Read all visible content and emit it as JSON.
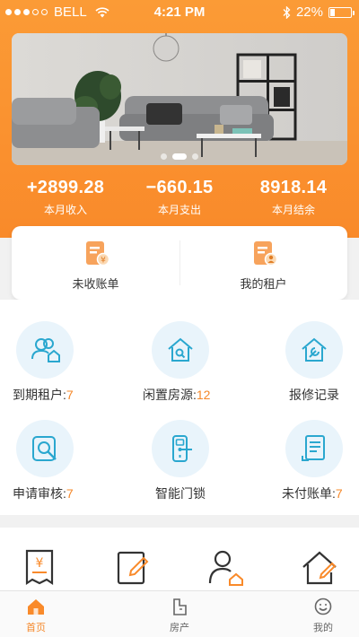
{
  "status_bar": {
    "carrier": "BELL",
    "time": "4:21 PM",
    "battery": "22%",
    "battery_level": 0.22
  },
  "banner": {
    "image": "living-room-sofa-photo",
    "indicator_count": 3,
    "active_indicator": 1
  },
  "stats": [
    {
      "value": "+2899.28",
      "label": "本月收入"
    },
    {
      "value": "−660.15",
      "label": "本月支出"
    },
    {
      "value": "8918.14",
      "label": "本月结余"
    }
  ],
  "quick_actions": [
    {
      "label": "未收账单",
      "icon": "unpaid-bill-icon"
    },
    {
      "label": "我的租户",
      "icon": "tenants-icon"
    }
  ],
  "features": [
    {
      "label": "到期租户:",
      "count": "7",
      "icon": "expiring-tenants-icon"
    },
    {
      "label": "闲置房源:",
      "count": "12",
      "icon": "vacant-house-icon"
    },
    {
      "label": "报修记录",
      "count": "",
      "icon": "repair-record-icon"
    },
    {
      "label": "申请审核:",
      "count": "7",
      "icon": "review-icon"
    },
    {
      "label": "智能门锁",
      "count": "",
      "icon": "smart-lock-icon"
    },
    {
      "label": "未付账单:",
      "count": "7",
      "icon": "unpaid-bills-icon"
    }
  ],
  "lower_icons": [
    "rent-receipt-icon",
    "edit-contract-icon",
    "add-tenant-icon",
    "edit-house-icon"
  ],
  "tabbar": {
    "items": [
      {
        "label": "首页",
        "icon": "home-icon",
        "active": true
      },
      {
        "label": "房产",
        "icon": "property-icon",
        "active": false
      },
      {
        "label": "我的",
        "icon": "profile-icon",
        "active": false
      }
    ]
  },
  "colors": {
    "brand_orange": "#f98a2a",
    "accent_blue": "#2aa7cf",
    "circle_bg": "#e9f4fb"
  }
}
